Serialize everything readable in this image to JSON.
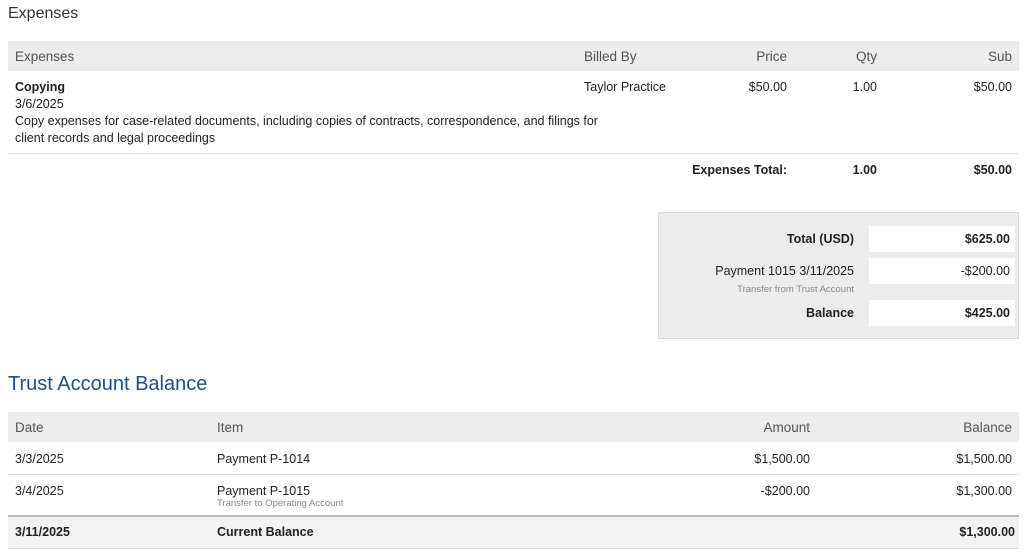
{
  "expenses_section": {
    "title": "Expenses",
    "headers": {
      "expenses": "Expenses",
      "billed_by": "Billed By",
      "price": "Price",
      "qty": "Qty",
      "sub": "Sub"
    },
    "item": {
      "name": "Copying",
      "date": "3/6/2025",
      "description_line1": "Copy expenses for case-related documents, including copies of contracts, correspondence, and filings for",
      "description_line2": "client records and legal proceedings",
      "billed_by": "Taylor Practice",
      "price": "$50.00",
      "qty": "1.00",
      "sub": "$50.00"
    },
    "total": {
      "label": "Expenses Total:",
      "qty": "1.00",
      "sub": "$50.00"
    }
  },
  "summary": {
    "total_label": "Total (USD)",
    "total_value": "$625.00",
    "payment_label": "Payment 1015 3/11/2025",
    "payment_note": "Transfer from Trust Account",
    "payment_value": "-$200.00",
    "balance_label": "Balance",
    "balance_value": "$425.00"
  },
  "trust": {
    "title": "Trust Account Balance",
    "headers": {
      "date": "Date",
      "item": "Item",
      "amount": "Amount",
      "balance": "Balance"
    },
    "rows": [
      {
        "date": "3/3/2025",
        "item": "Payment P-1014",
        "note": "",
        "amount": "$1,500.00",
        "balance": "$1,500.00"
      },
      {
        "date": "3/4/2025",
        "item": "Payment P-1015",
        "note": "Transfer to Operating Account",
        "amount": "-$200.00",
        "balance": "$1,300.00"
      }
    ],
    "current": {
      "date": "3/11/2025",
      "label": "Current Balance",
      "balance": "$1,300.00"
    }
  }
}
